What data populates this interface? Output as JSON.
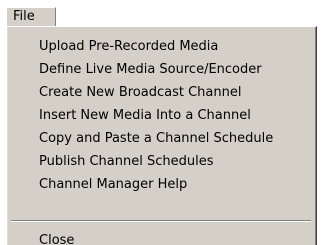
{
  "menu": {
    "title": "File",
    "items": [
      "Upload Pre-Recorded Media",
      "Define Live Media Source/Encoder",
      "Create New Broadcast Channel",
      "Insert New Media Into a Channel",
      "Copy and Paste a Channel Schedule",
      "Publish Channel Schedules",
      "Channel Manager Help"
    ],
    "close_label": "Close"
  }
}
